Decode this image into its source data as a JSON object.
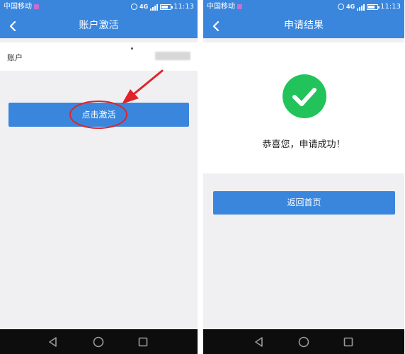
{
  "left_screen": {
    "status": {
      "carrier": "中国移动",
      "network": "4G",
      "time": "11:13"
    },
    "title": "账户激活",
    "account_label": "账户",
    "activate_button": "点击激活"
  },
  "right_screen": {
    "status": {
      "carrier": "中国移动",
      "network": "4G",
      "time": "11:13"
    },
    "title": "申请结果",
    "result_message": "恭喜您，申请成功！",
    "home_button": "返回首页"
  },
  "colors": {
    "primary": "#3a86dd",
    "success": "#22c35a",
    "annotation": "#e0242a",
    "background": "#f0f0f2"
  },
  "icons": [
    "back-arrow-icon",
    "alarm-icon",
    "signal-icon",
    "battery-icon",
    "checkmark-icon",
    "nav-back-icon",
    "nav-home-icon",
    "nav-recent-icon"
  ]
}
